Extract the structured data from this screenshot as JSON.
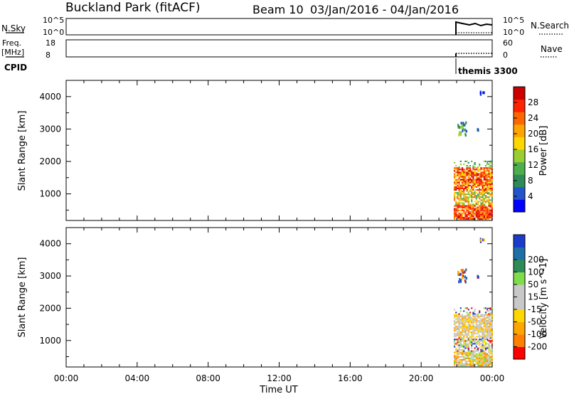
{
  "header": {
    "station": "Buckland Park (fitACF)",
    "beam": "Beam 10",
    "date_range": "03/Jan/2016 - 04/Jan/2016"
  },
  "left_labels": {
    "nsky": "N.Sky",
    "freq": "Freq.",
    "freq_unit": "[MHz]",
    "cpid": "CPID"
  },
  "right_labels": {
    "nsearch": "N.Search",
    "nave": "Nave"
  },
  "cpid_name": "themis 3300",
  "colors": {
    "power": [
      "#0000ff",
      "#2255cc",
      "#2e8b57",
      "#4cae4c",
      "#9acd32",
      "#ffd700",
      "#ffa500",
      "#ff6600",
      "#ff2200",
      "#cc0000"
    ],
    "velocity": [
      "#ff0000",
      "#ff7f00",
      "#ffa500",
      "#ffd700",
      "#c8c8c8",
      "#c8c8c8",
      "#7fdd4c",
      "#2e8b57",
      "#1e6fa8",
      "#1a3cc8"
    ]
  },
  "chart_data": [
    {
      "type": "line",
      "name": "noise",
      "y_tick_labels": [
        "10^5",
        "10^0"
      ],
      "right_tick_labels": [
        "10^5",
        "10^0"
      ],
      "data_start_time": "21:50"
    },
    {
      "type": "line",
      "name": "freq-nave",
      "left_ticks": [
        "18",
        "8"
      ],
      "right_ticks": [
        "60",
        "0"
      ],
      "data_start_time": "21:50"
    },
    {
      "type": "heatmap",
      "name": "power",
      "ylabel": "Slant Range [km]",
      "ylim": [
        180,
        4500
      ],
      "yticks": [
        1000,
        2000,
        3000,
        4000
      ],
      "colorbar_label": "Power [dB]",
      "colorbar_ticks": [
        "4",
        "8",
        "12",
        "16",
        "20",
        "24",
        "28"
      ],
      "data_start_time": "21:50"
    },
    {
      "type": "heatmap",
      "name": "velocity",
      "ylabel": "Slant Range [km]",
      "ylim": [
        180,
        4500
      ],
      "yticks": [
        1000,
        2000,
        3000,
        4000
      ],
      "colorbar_label": "Velocity [m s^-1]",
      "colorbar_ticks": [
        "-200",
        "-100",
        "-50",
        "-15",
        "15",
        "50",
        "100",
        "200"
      ],
      "xlabel": "Time UT",
      "xticks": [
        "00:00",
        "04:00",
        "08:00",
        "12:00",
        "16:00",
        "20:00",
        "00:00"
      ],
      "xlim_hours": [
        0,
        24
      ],
      "data_start_time": "21:50"
    }
  ]
}
